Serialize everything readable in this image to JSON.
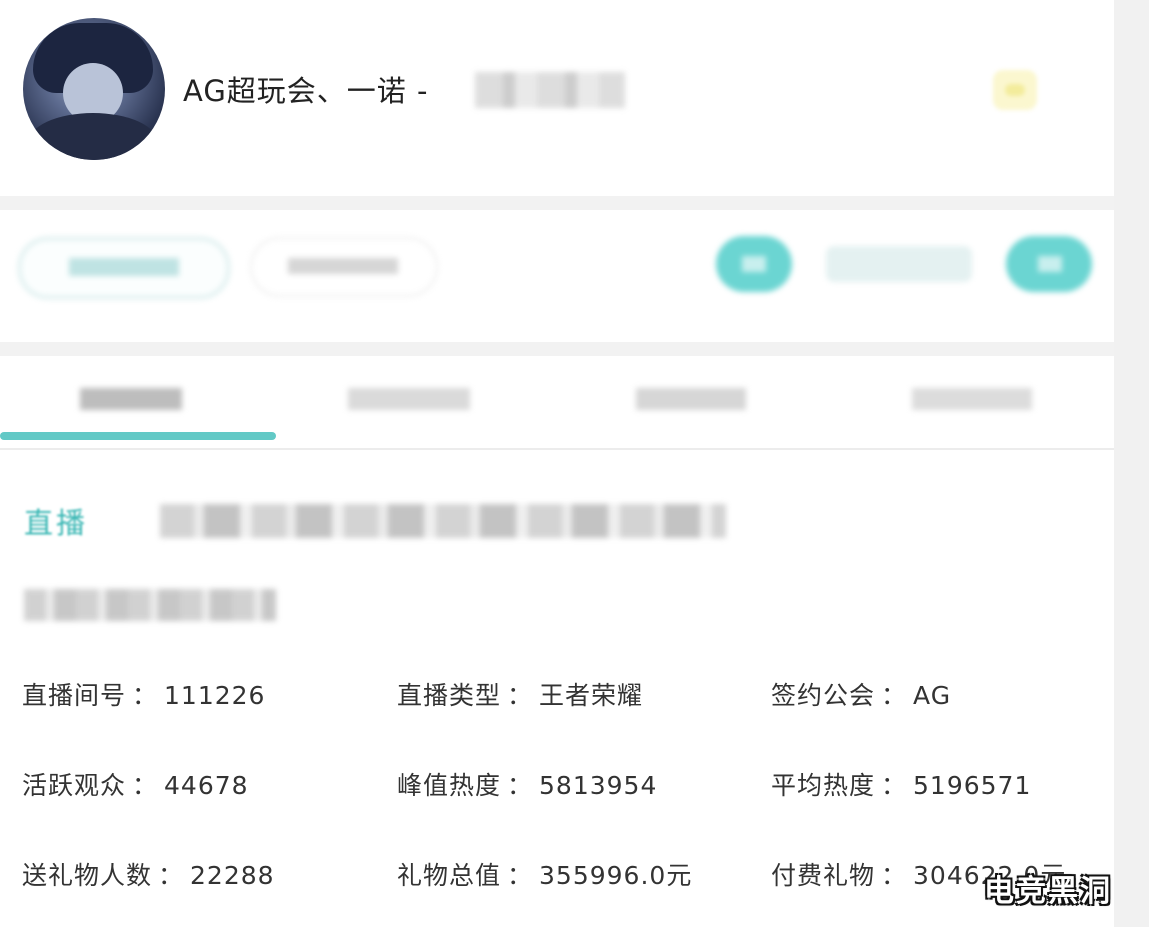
{
  "header": {
    "streamer_name": "AG超玩会、一诺 -"
  },
  "live": {
    "label": "直播"
  },
  "stats": [
    {
      "label": "直播间号",
      "value": "111226"
    },
    {
      "label": "直播类型",
      "value": "王者荣耀"
    },
    {
      "label": "签约公会",
      "value": "AG"
    },
    {
      "label": "活跃观众",
      "value": "44678"
    },
    {
      "label": "峰值热度",
      "value": "5813954"
    },
    {
      "label": "平均热度",
      "value": "5196571"
    },
    {
      "label": "送礼物人数",
      "value": "22288"
    },
    {
      "label": "礼物总值",
      "value": "355996.0元"
    },
    {
      "label": "付费礼物",
      "value": "304622.0元"
    }
  ],
  "separator": "：",
  "watermark": "电竞黑洞",
  "colors": {
    "accent": "#3ab7b4",
    "tab_indicator": "#62c9c6",
    "background": "#ffffff",
    "divider": "#f2f2f2"
  }
}
